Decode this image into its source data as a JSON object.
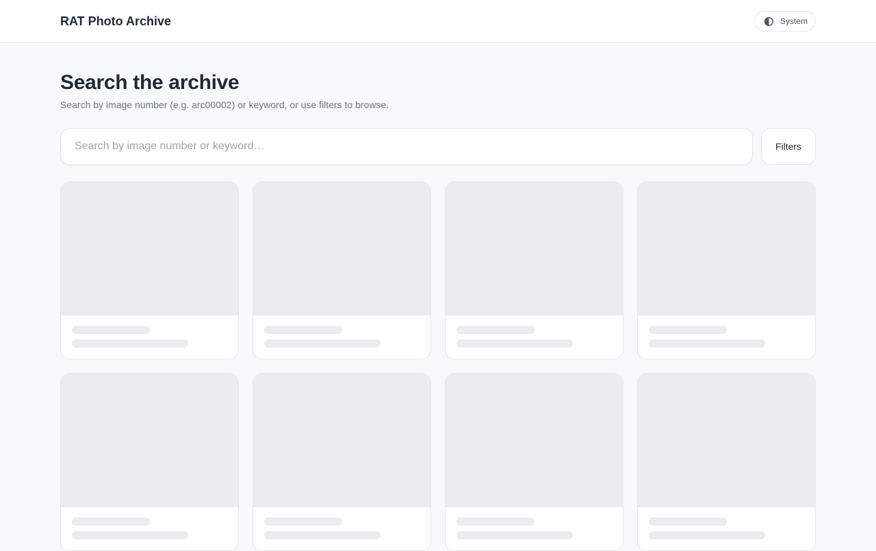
{
  "header": {
    "brand": "RAT Photo Archive",
    "theme_toggle": {
      "icon": "half-circle-contrast-icon",
      "label": "System"
    }
  },
  "main": {
    "title": "Search the archive",
    "subtitle": "Search by image number (e.g. arc00002) or keyword, or use filters to browse.",
    "search": {
      "value": "",
      "placeholder": "Search by image number or keyword…"
    },
    "filters_label": "Filters",
    "results": {
      "state": "loading",
      "placeholder_cards": 8
    }
  },
  "colors": {
    "page_background": "#f8f9fb",
    "surface": "#ffffff",
    "border": "#e5e7eb",
    "skeleton": "#ebecf0",
    "text_primary": "#1f2937",
    "text_secondary": "#6b7280"
  }
}
